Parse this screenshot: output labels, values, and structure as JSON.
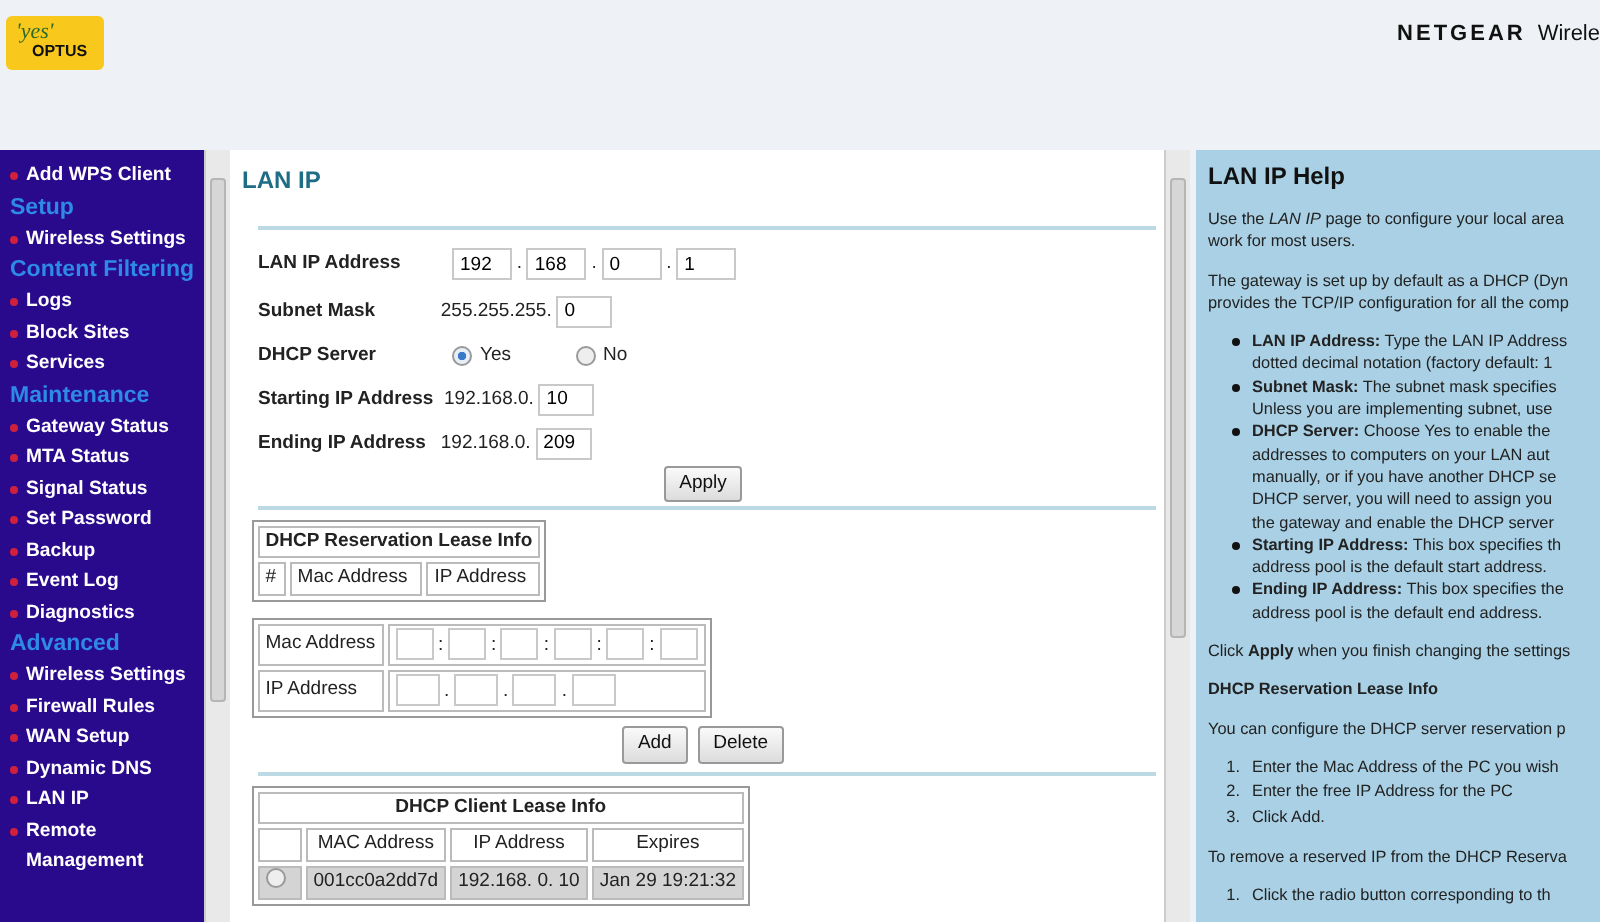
{
  "header": {
    "logo": {
      "line_1": "'yes'",
      "line_2": "OPTUS"
    },
    "brand": "NETGEAR",
    "product": "Wirele"
  },
  "sidebar": {
    "items": [
      {
        "kind": "link",
        "label": "Add WPS Client"
      },
      {
        "kind": "heading",
        "label": "Setup"
      },
      {
        "kind": "link",
        "label": "Wireless Settings"
      },
      {
        "kind": "heading",
        "label": "Content Filtering"
      },
      {
        "kind": "link",
        "label": "Logs"
      },
      {
        "kind": "link",
        "label": "Block Sites"
      },
      {
        "kind": "link",
        "label": "Services"
      },
      {
        "kind": "heading",
        "label": "Maintenance"
      },
      {
        "kind": "link",
        "label": "Gateway Status"
      },
      {
        "kind": "link",
        "label": "MTA Status"
      },
      {
        "kind": "link",
        "label": "Signal Status"
      },
      {
        "kind": "link",
        "label": "Set Password"
      },
      {
        "kind": "link",
        "label": "Backup"
      },
      {
        "kind": "link",
        "label": "Event Log"
      },
      {
        "kind": "link",
        "label": "Diagnostics"
      },
      {
        "kind": "heading",
        "label": "Advanced"
      },
      {
        "kind": "link",
        "label": "Wireless Settings"
      },
      {
        "kind": "link",
        "label": "Firewall Rules"
      },
      {
        "kind": "link",
        "label": "WAN Setup"
      },
      {
        "kind": "link",
        "label": "Dynamic DNS"
      },
      {
        "kind": "link",
        "label": "LAN IP"
      },
      {
        "kind": "link",
        "label": "Remote Management"
      }
    ]
  },
  "main": {
    "title": "LAN IP",
    "lan_ip": {
      "label": "LAN IP Address",
      "octets": [
        "192",
        "168",
        "0",
        "1"
      ],
      "separator": "."
    },
    "subnet": {
      "label": "Subnet Mask",
      "prefix": "255.255.255.",
      "value": "0"
    },
    "dhcp_server": {
      "label": "DHCP Server",
      "options": [
        {
          "label": "Yes",
          "selected": true
        },
        {
          "label": "No",
          "selected": false
        }
      ]
    },
    "start_ip": {
      "label": "Starting IP Address",
      "prefix": "192.168.0.",
      "value": "10"
    },
    "end_ip": {
      "label": "Ending IP Address",
      "prefix": "192.168.0.",
      "value": "209"
    },
    "apply_button": "Apply",
    "reservation_table": {
      "title": "DHCP Reservation Lease Info",
      "columns": [
        "#",
        "Mac Address",
        "IP Address"
      ]
    },
    "reservation_form": {
      "mac_label": "Mac Address",
      "ip_label": "IP Address",
      "mac_separator": ":",
      "ip_separator": "."
    },
    "buttons": [
      "Add",
      "Delete"
    ],
    "client_table": {
      "title": "DHCP Client Lease Info",
      "columns": [
        "MAC Address",
        "IP Address",
        "Expires"
      ],
      "rows": [
        {
          "selected": false,
          "cells": [
            "001cc0a2dd7d",
            "192.168. 0. 10",
            "Jan 29 19:21:32"
          ]
        }
      ]
    }
  },
  "help": {
    "title": "LAN IP Help",
    "blocks": [
      {
        "kind": "para",
        "lines": [
          "Use the *LAN IP* page to configure your local area",
          "work for most users."
        ]
      },
      {
        "kind": "para",
        "lines": [
          "The gateway is set up by default as a DHCP (Dyn",
          "provides the TCP/IP configuration for all the comp"
        ]
      },
      {
        "kind": "bullets",
        "items": [
          {
            "lines": [
              "**LAN IP Address:** Type the LAN IP Address",
              "dotted decimal notation (factory default: 1"
            ]
          },
          {
            "lines": [
              "**Subnet Mask:** The subnet mask specifies",
              "Unless you are implementing subnet, use"
            ]
          },
          {
            "lines": [
              "**DHCP Server:** Choose Yes to enable the",
              "addresses to computers on your LAN aut",
              "manually, or if you have another DHCP se",
              "DHCP server, you will need to assign you",
              "the gateway and enable the DHCP server"
            ]
          },
          {
            "lines": [
              "**Starting IP Address:** This box specifies th",
              "address pool is the default start address."
            ]
          },
          {
            "lines": [
              "**Ending IP Address:** This box specifies the",
              "address pool is the default end address."
            ]
          }
        ]
      },
      {
        "kind": "para",
        "lines": [
          "Click **Apply** when you finish changing the settings"
        ]
      },
      {
        "kind": "heading",
        "lines": [
          "DHCP Reservation Lease Info"
        ]
      },
      {
        "kind": "para",
        "lines": [
          "You can configure the DHCP server reservation p"
        ]
      },
      {
        "kind": "steps",
        "items": [
          {
            "number": "1.",
            "lines": [
              "Enter the Mac Address of the PC you wish"
            ]
          },
          {
            "number": "2.",
            "lines": [
              "Enter the free IP Address for the PC"
            ]
          },
          {
            "number": "3.",
            "lines": [
              "Click Add."
            ]
          }
        ]
      },
      {
        "kind": "para",
        "lines": [
          "To remove a reserved IP from the DHCP Reserva"
        ]
      },
      {
        "kind": "steps",
        "items": [
          {
            "number": "1.",
            "lines": [
              "Click the radio button corresponding to th"
            ]
          }
        ]
      }
    ]
  }
}
